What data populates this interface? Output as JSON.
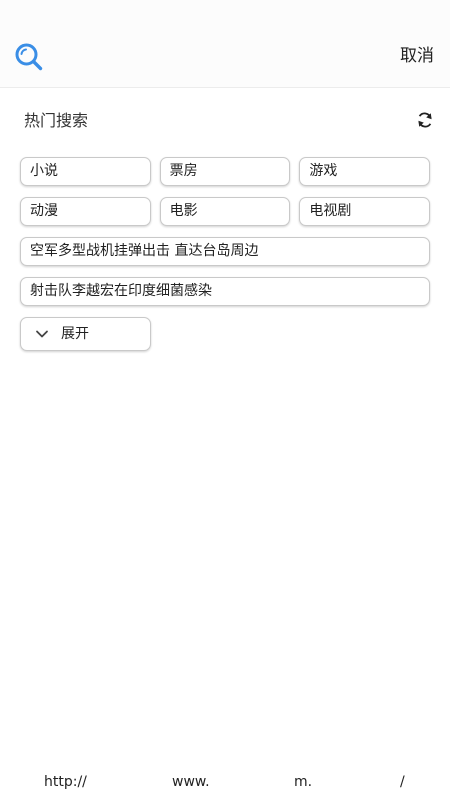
{
  "header": {
    "cancel_label": "取消",
    "icon": "search-icon"
  },
  "hot": {
    "title": "热门搜索",
    "refresh_icon": "refresh-icon",
    "row1": [
      "小说",
      "票房",
      "游戏"
    ],
    "row2": [
      "动漫",
      "电影",
      "电视剧"
    ],
    "news1": "空军多型战机挂弹出击 直达台岛周边",
    "news2": "射击队李越宏在印度细菌感染",
    "expand_label": "展开"
  },
  "footer": {
    "parts": [
      "http://",
      "www.",
      "m.",
      "/"
    ]
  },
  "colors": {
    "accent": "#3a8ee6",
    "tag_border": "#c9c9c9"
  }
}
